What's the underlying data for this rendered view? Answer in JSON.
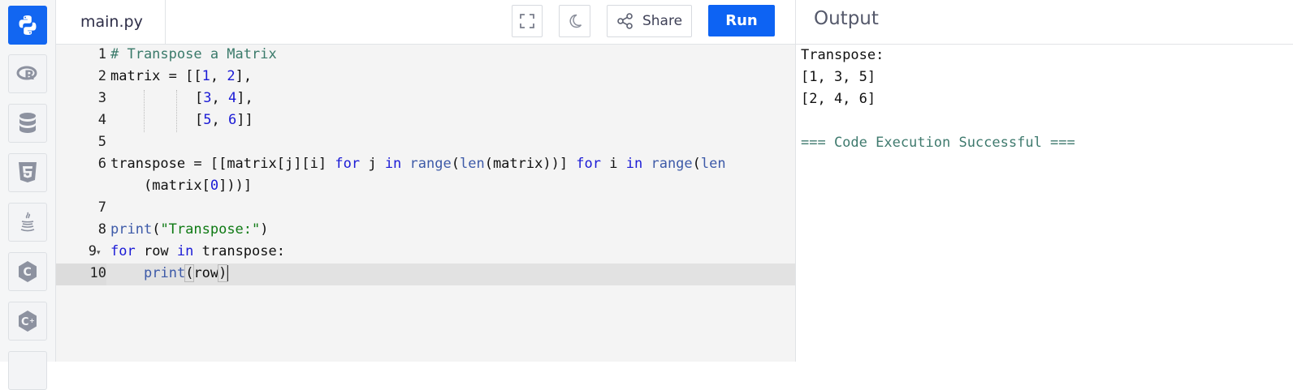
{
  "rail": {
    "languages": [
      "python",
      "r",
      "sql",
      "html5",
      "java",
      "c",
      "cpp"
    ]
  },
  "editor": {
    "file_name": "main.py",
    "toolbar": {
      "share_label": "Share",
      "run_label": "Run"
    },
    "line_numbers": [
      "1",
      "2",
      "3",
      "4",
      "5",
      "6",
      "7",
      "8",
      "9",
      "10"
    ]
  },
  "code": {
    "l1": "# Transpose a Matrix",
    "l2_var": "matrix",
    "l2_eq": " = ",
    "l2_open": "[[",
    "l2_n1": "1",
    "l2_comma": ", ",
    "l2_n2": "2",
    "l2_close": "],",
    "l3_open": "[",
    "l3_n1": "3",
    "l3_comma": ", ",
    "l3_n2": "4",
    "l3_close": "],",
    "l4_open": "[",
    "l4_n1": "5",
    "l4_comma": ", ",
    "l4_n2": "6",
    "l4_close": "]]",
    "l6_a": "transpose",
    "l6_eq": " = ",
    "l6_b": "[[matrix[j][i] ",
    "l6_for1": "for",
    "l6_c": " j ",
    "l6_in1": "in",
    "l6_d": " ",
    "l6_range1": "range",
    "l6_e": "(",
    "l6_len1": "len",
    "l6_f": "(matrix))] ",
    "l6_for2": "for",
    "l6_g": " i ",
    "l6_in2": "in",
    "l6_h": " ",
    "l6_range2": "range",
    "l6_i": "(",
    "l6_len2": "len",
    "l6w_a": "(matrix[",
    "l6w_n": "0",
    "l6w_b": "]))]",
    "l8_print": "print",
    "l8_open": "(",
    "l8_str": "\"Transpose:\"",
    "l8_close": ")",
    "l9_for": "for",
    "l9_mid": " row ",
    "l9_in": "in",
    "l9_end": " transpose:",
    "l10_print": "print",
    "l10_open": "(",
    "l10_arg": "row",
    "l10_close": ")"
  },
  "output": {
    "title": "Output",
    "lines": [
      "Transpose:",
      "[1, 3, 5]",
      "[2, 4, 6]",
      "",
      "=== Code Execution Successful ==="
    ]
  },
  "colors": {
    "accent": "#0d63f3",
    "keyword": "#1b1bd6",
    "string": "#0f7a14",
    "comment": "#3a7a6a"
  }
}
